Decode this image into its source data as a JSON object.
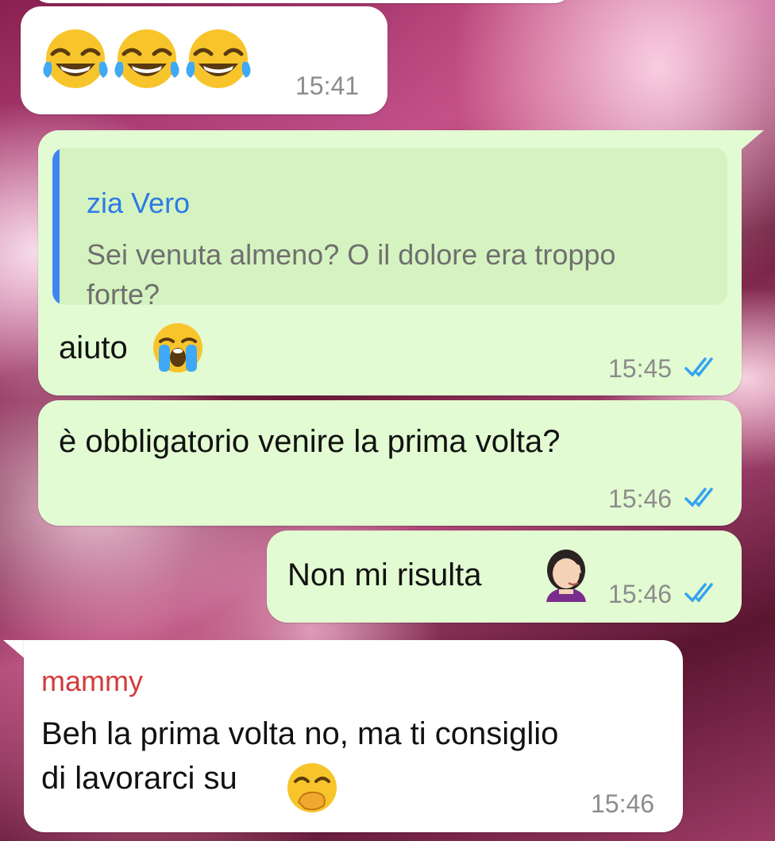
{
  "messages": [
    {
      "id": "m1",
      "direction": "incoming",
      "emoji": [
        "tears-of-joy-emoji",
        "tears-of-joy-emoji",
        "tears-of-joy-emoji"
      ],
      "time": "15:41"
    },
    {
      "id": "m2",
      "direction": "outgoing",
      "reply": {
        "author": "zia Vero",
        "text_line1": "Sei venuta almeno? O il dolore era troppo",
        "text_line2": "forte?"
      },
      "text": "aiuto",
      "emoji": "loudly-crying-face-emoji",
      "time": "15:45",
      "status": "read"
    },
    {
      "id": "m3",
      "direction": "outgoing",
      "text": "è obbligatorio venire la prima volta?",
      "time": "15:46",
      "status": "read"
    },
    {
      "id": "m4",
      "direction": "outgoing",
      "text": "Non mi risulta",
      "emoji": "woman-facepalming-emoji",
      "time": "15:46",
      "status": "read"
    },
    {
      "id": "m5",
      "direction": "incoming",
      "sender": "mammy",
      "text_line1": "Beh la prima volta no, ma ti consiglio",
      "text_line2": "di lavorarci su",
      "emoji": "hand-over-mouth-emoji",
      "time": "15:46"
    }
  ],
  "colors": {
    "incoming_bubble": "#ffffff",
    "outgoing_bubble": "#e2fbd2",
    "quote_bar": "#3f86f0",
    "quote_author": "#2c7ae8",
    "sender_name": "#d33b3b",
    "read_ticks": "#34a3f0"
  }
}
